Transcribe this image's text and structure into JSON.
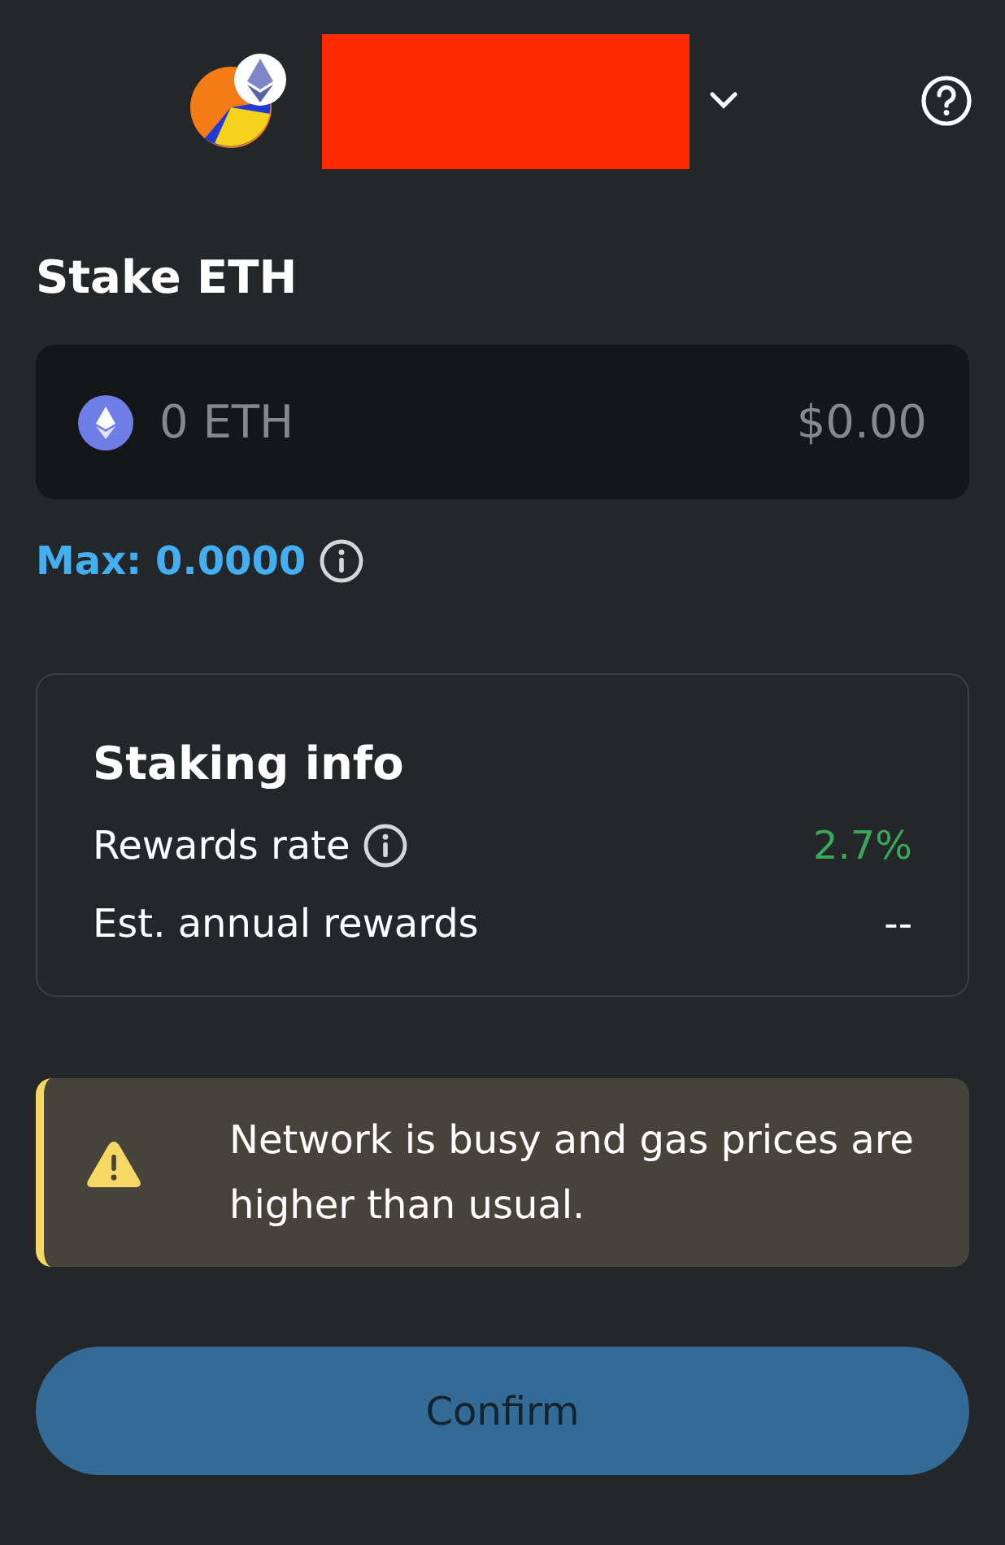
{
  "header": {
    "account_redacted": true
  },
  "title": "Stake ETH",
  "amount": {
    "placeholder": "0 ETH",
    "fiat": "$0.00"
  },
  "max": {
    "label": "Max: 0.0000"
  },
  "staking_info": {
    "title": "Staking info",
    "rows": [
      {
        "label": "Rewards rate",
        "info": true,
        "value": "2.7%",
        "color": "#39a858"
      },
      {
        "label": "Est. annual rewards",
        "info": false,
        "value": "--",
        "color": "#ffffff"
      }
    ]
  },
  "warning": {
    "text": "Network is busy and gas prices are higher than usual."
  },
  "confirm": {
    "label": "Confirm",
    "disabled": true
  }
}
